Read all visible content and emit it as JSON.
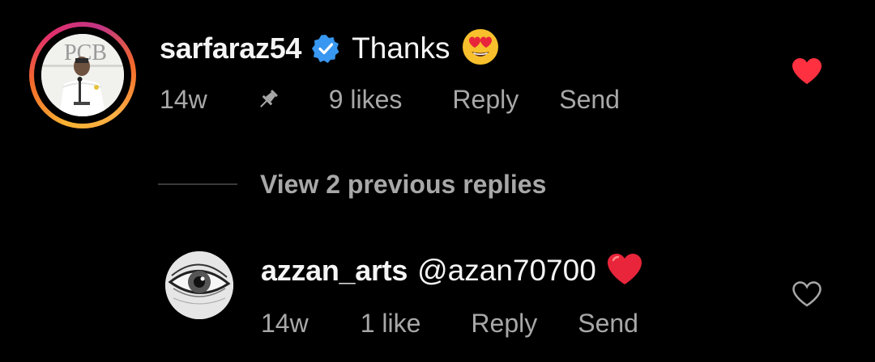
{
  "comments": [
    {
      "username": "sarfaraz54",
      "verified": true,
      "text": "Thanks",
      "emoji": "heart-eyes-emoji",
      "time": "14w",
      "pinned": true,
      "likes": "9 likes",
      "reply_label": "Reply",
      "send_label": "Send",
      "liked": true
    }
  ],
  "view_replies": "View 2 previous replies",
  "replies": [
    {
      "username": "azzan_arts",
      "text": "@azan70700",
      "emoji": "red-heart-emoji",
      "time": "14w",
      "likes": "1 like",
      "reply_label": "Reply",
      "send_label": "Send",
      "liked": false
    }
  ],
  "colors": {
    "background": "#000000",
    "primary_text": "#f5f5f5",
    "secondary_text": "#a8a8a8",
    "verified_blue": "#3897f0",
    "like_red": "#ff3040"
  }
}
